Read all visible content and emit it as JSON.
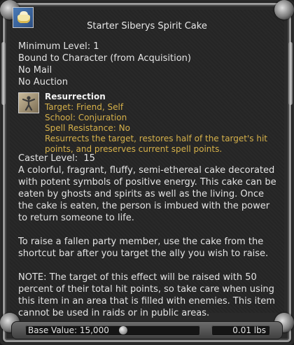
{
  "item": {
    "title": "Starter Siberys Spirit Cake",
    "icon": "cake-icon"
  },
  "properties": [
    "Minimum Level: 1",
    "Bound to Character (from Acquisition)",
    "No Mail",
    "No Auction"
  ],
  "spell": {
    "icon": "resurrection-figure-icon",
    "name": "Resurrection",
    "target": "Target: Friend, Self",
    "school": "School: Conjuration",
    "resistance": "Spell Resistance: No",
    "description": "Resurrects the target, restores half of the target's hit points, and preserves current spell points."
  },
  "caster_level": "Caster Level:  15",
  "description": [
    "A colorful, fragrant, fluffy, semi-ethereal cake decorated with potent symbols of positive energy. This cake can be eaten by ghosts and spirits as well as the living. Once the cake is eaten, the person is imbued with the power to return someone to life.",
    "To raise a fallen party member, use the cake from the shortcut bar after you target the ally you wish to raise.",
    "NOTE: The target of this effect will be raised with 50 percent of their total hit points, so take care when using this item in an area that is filled with enemies. This item cannot be used in raids or in public areas."
  ],
  "footer": {
    "base_value": "Base Value: 15,000",
    "coin_icon": "silver-coin-icon",
    "weight": "0.01 lbs"
  },
  "colors": {
    "spell_text": "#d6b14a",
    "body_text": "#e4e4e4",
    "background": "#262626"
  }
}
